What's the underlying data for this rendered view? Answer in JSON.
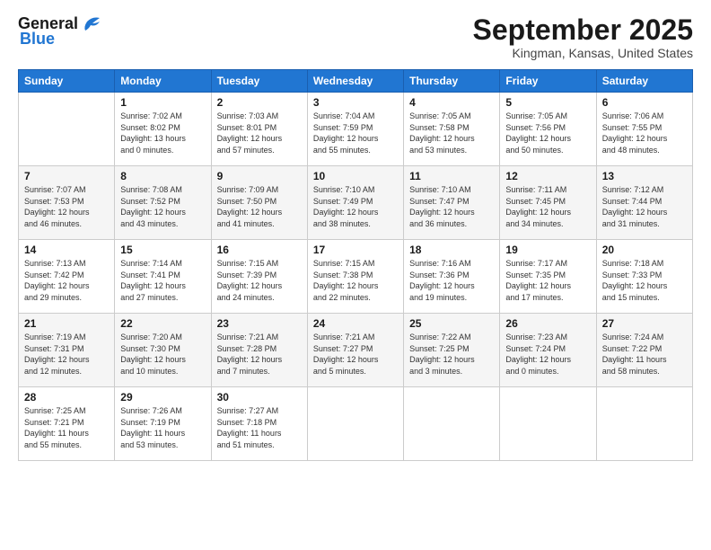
{
  "header": {
    "logo_general": "General",
    "logo_blue": "Blue",
    "month_title": "September 2025",
    "location": "Kingman, Kansas, United States"
  },
  "days_of_week": [
    "Sunday",
    "Monday",
    "Tuesday",
    "Wednesday",
    "Thursday",
    "Friday",
    "Saturday"
  ],
  "weeks": [
    [
      {
        "day": "",
        "info": ""
      },
      {
        "day": "1",
        "info": "Sunrise: 7:02 AM\nSunset: 8:02 PM\nDaylight: 13 hours\nand 0 minutes."
      },
      {
        "day": "2",
        "info": "Sunrise: 7:03 AM\nSunset: 8:01 PM\nDaylight: 12 hours\nand 57 minutes."
      },
      {
        "day": "3",
        "info": "Sunrise: 7:04 AM\nSunset: 7:59 PM\nDaylight: 12 hours\nand 55 minutes."
      },
      {
        "day": "4",
        "info": "Sunrise: 7:05 AM\nSunset: 7:58 PM\nDaylight: 12 hours\nand 53 minutes."
      },
      {
        "day": "5",
        "info": "Sunrise: 7:05 AM\nSunset: 7:56 PM\nDaylight: 12 hours\nand 50 minutes."
      },
      {
        "day": "6",
        "info": "Sunrise: 7:06 AM\nSunset: 7:55 PM\nDaylight: 12 hours\nand 48 minutes."
      }
    ],
    [
      {
        "day": "7",
        "info": "Sunrise: 7:07 AM\nSunset: 7:53 PM\nDaylight: 12 hours\nand 46 minutes."
      },
      {
        "day": "8",
        "info": "Sunrise: 7:08 AM\nSunset: 7:52 PM\nDaylight: 12 hours\nand 43 minutes."
      },
      {
        "day": "9",
        "info": "Sunrise: 7:09 AM\nSunset: 7:50 PM\nDaylight: 12 hours\nand 41 minutes."
      },
      {
        "day": "10",
        "info": "Sunrise: 7:10 AM\nSunset: 7:49 PM\nDaylight: 12 hours\nand 38 minutes."
      },
      {
        "day": "11",
        "info": "Sunrise: 7:10 AM\nSunset: 7:47 PM\nDaylight: 12 hours\nand 36 minutes."
      },
      {
        "day": "12",
        "info": "Sunrise: 7:11 AM\nSunset: 7:45 PM\nDaylight: 12 hours\nand 34 minutes."
      },
      {
        "day": "13",
        "info": "Sunrise: 7:12 AM\nSunset: 7:44 PM\nDaylight: 12 hours\nand 31 minutes."
      }
    ],
    [
      {
        "day": "14",
        "info": "Sunrise: 7:13 AM\nSunset: 7:42 PM\nDaylight: 12 hours\nand 29 minutes."
      },
      {
        "day": "15",
        "info": "Sunrise: 7:14 AM\nSunset: 7:41 PM\nDaylight: 12 hours\nand 27 minutes."
      },
      {
        "day": "16",
        "info": "Sunrise: 7:15 AM\nSunset: 7:39 PM\nDaylight: 12 hours\nand 24 minutes."
      },
      {
        "day": "17",
        "info": "Sunrise: 7:15 AM\nSunset: 7:38 PM\nDaylight: 12 hours\nand 22 minutes."
      },
      {
        "day": "18",
        "info": "Sunrise: 7:16 AM\nSunset: 7:36 PM\nDaylight: 12 hours\nand 19 minutes."
      },
      {
        "day": "19",
        "info": "Sunrise: 7:17 AM\nSunset: 7:35 PM\nDaylight: 12 hours\nand 17 minutes."
      },
      {
        "day": "20",
        "info": "Sunrise: 7:18 AM\nSunset: 7:33 PM\nDaylight: 12 hours\nand 15 minutes."
      }
    ],
    [
      {
        "day": "21",
        "info": "Sunrise: 7:19 AM\nSunset: 7:31 PM\nDaylight: 12 hours\nand 12 minutes."
      },
      {
        "day": "22",
        "info": "Sunrise: 7:20 AM\nSunset: 7:30 PM\nDaylight: 12 hours\nand 10 minutes."
      },
      {
        "day": "23",
        "info": "Sunrise: 7:21 AM\nSunset: 7:28 PM\nDaylight: 12 hours\nand 7 minutes."
      },
      {
        "day": "24",
        "info": "Sunrise: 7:21 AM\nSunset: 7:27 PM\nDaylight: 12 hours\nand 5 minutes."
      },
      {
        "day": "25",
        "info": "Sunrise: 7:22 AM\nSunset: 7:25 PM\nDaylight: 12 hours\nand 3 minutes."
      },
      {
        "day": "26",
        "info": "Sunrise: 7:23 AM\nSunset: 7:24 PM\nDaylight: 12 hours\nand 0 minutes."
      },
      {
        "day": "27",
        "info": "Sunrise: 7:24 AM\nSunset: 7:22 PM\nDaylight: 11 hours\nand 58 minutes."
      }
    ],
    [
      {
        "day": "28",
        "info": "Sunrise: 7:25 AM\nSunset: 7:21 PM\nDaylight: 11 hours\nand 55 minutes."
      },
      {
        "day": "29",
        "info": "Sunrise: 7:26 AM\nSunset: 7:19 PM\nDaylight: 11 hours\nand 53 minutes."
      },
      {
        "day": "30",
        "info": "Sunrise: 7:27 AM\nSunset: 7:18 PM\nDaylight: 11 hours\nand 51 minutes."
      },
      {
        "day": "",
        "info": ""
      },
      {
        "day": "",
        "info": ""
      },
      {
        "day": "",
        "info": ""
      },
      {
        "day": "",
        "info": ""
      }
    ]
  ]
}
